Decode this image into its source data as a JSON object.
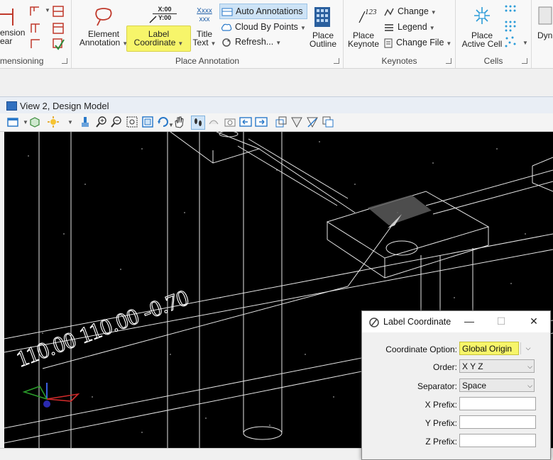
{
  "ribbon": {
    "groups": {
      "dimensioning": {
        "label": "mensioning",
        "partial_buttons": [
          "ension",
          "ear"
        ]
      },
      "place_annotation": {
        "label": "Place Annotation",
        "element_annotation": {
          "line1": "Element",
          "line2": "Annotation"
        },
        "label_coordinate": {
          "line1": "Label",
          "line2": "Coordinate",
          "icon_x": "X:00",
          "icon_y": "Y:00"
        },
        "title_text": {
          "line1": "Title",
          "line2": "Text",
          "icon_a": "Xxxx",
          "icon_b": "xxx"
        },
        "auto_annotations": "Auto Annotations",
        "cloud_by_points": "Cloud By Points",
        "refresh": "Refresh...",
        "place_outline": {
          "line1": "Place",
          "line2": "Outline"
        }
      },
      "keynotes": {
        "label": "Keynotes",
        "place_keynote": {
          "line1": "Place",
          "line2": "Keynote",
          "icon_text": "123"
        },
        "change": "Change",
        "legend": "Legend",
        "change_file": "Change File"
      },
      "cells": {
        "label": "Cells",
        "place_active_cell": {
          "line1": "Place",
          "line2": "Active Cell"
        }
      },
      "partial_right": {
        "line1": "Dyn"
      }
    }
  },
  "view": {
    "title": "View 2, Design Model",
    "canvas": {
      "annotation_text": "110.00 110.00 -0.70",
      "background": "#000000",
      "line_color": "#e8e8e8"
    }
  },
  "dialog": {
    "title": "Label Coordinate",
    "min_label": "—",
    "max_label": "☐",
    "close_label": "✕",
    "fields": {
      "coordinate_option": {
        "label": "Coordinate Option:",
        "value": "Global Origin"
      },
      "order": {
        "label": "Order:",
        "value": "X Y Z"
      },
      "separator": {
        "label": "Separator:",
        "value": "Space"
      },
      "x_prefix": {
        "label": "X Prefix:",
        "value": ""
      },
      "y_prefix": {
        "label": "Y Prefix:",
        "value": ""
      },
      "z_prefix": {
        "label": "Z Prefix:",
        "value": ""
      }
    }
  },
  "colors": {
    "highlight": "#f7f56a",
    "accent_blue": "#2a79c9",
    "ribbon_bg": "#f8f8f8"
  }
}
